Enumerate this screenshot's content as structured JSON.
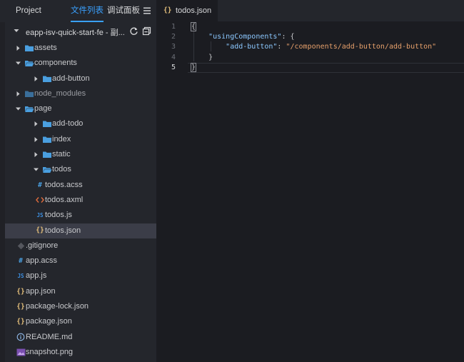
{
  "sidebar": {
    "tabs": [
      {
        "label": "Project",
        "active": false
      },
      {
        "label": "文件列表",
        "active": true
      },
      {
        "label": "调试面板",
        "active": false
      }
    ],
    "menu_icon": "menu-icon",
    "project": {
      "name": "eapp-isv-quick-start-fe - 副...",
      "refresh_icon": "refresh-icon",
      "collapse_icon": "collapse-all-icon"
    },
    "tree": [
      {
        "label": "assets",
        "type": "folder",
        "depth": 0,
        "expanded": false
      },
      {
        "label": "components",
        "type": "folder",
        "depth": 0,
        "expanded": true
      },
      {
        "label": "add-button",
        "type": "folder",
        "depth": 1,
        "expanded": false
      },
      {
        "label": "node_modules",
        "type": "folder-muted",
        "depth": 0,
        "expanded": false
      },
      {
        "label": "page",
        "type": "folder",
        "depth": 0,
        "expanded": true
      },
      {
        "label": "add-todo",
        "type": "folder",
        "depth": 1,
        "expanded": false
      },
      {
        "label": "index",
        "type": "folder",
        "depth": 1,
        "expanded": false
      },
      {
        "label": "static",
        "type": "folder",
        "depth": 1,
        "expanded": false
      },
      {
        "label": "todos",
        "type": "folder",
        "depth": 1,
        "expanded": true
      },
      {
        "label": "todos.acss",
        "type": "acss",
        "depth": 2
      },
      {
        "label": "todos.axml",
        "type": "axml",
        "depth": 2
      },
      {
        "label": "todos.js",
        "type": "js",
        "depth": 2
      },
      {
        "label": "todos.json",
        "type": "json",
        "depth": 2,
        "selected": true
      },
      {
        "label": ".gitignore",
        "type": "gitignore",
        "depth": 0
      },
      {
        "label": "app.acss",
        "type": "acss",
        "depth": 0
      },
      {
        "label": "app.js",
        "type": "js",
        "depth": 0
      },
      {
        "label": "app.json",
        "type": "json",
        "depth": 0
      },
      {
        "label": "package-lock.json",
        "type": "json",
        "depth": 0
      },
      {
        "label": "package.json",
        "type": "json",
        "depth": 0
      },
      {
        "label": "README.md",
        "type": "info",
        "depth": 0
      },
      {
        "label": "snapshot.png",
        "type": "image",
        "depth": 0
      }
    ]
  },
  "editor": {
    "tab": {
      "icon_text": "{}",
      "label": "todos.json"
    },
    "current_line": 5,
    "lines": [
      {
        "num": "1",
        "tokens": [
          {
            "t": "{",
            "c": "punc",
            "box": true
          }
        ]
      },
      {
        "num": "2",
        "tokens": [
          {
            "t": "    ",
            "c": "punc"
          },
          {
            "t": "\"usingComponents\"",
            "c": "key"
          },
          {
            "t": ": {",
            "c": "punc"
          }
        ]
      },
      {
        "num": "3",
        "tokens": [
          {
            "t": "        ",
            "c": "punc"
          },
          {
            "t": "\"add-button\"",
            "c": "key"
          },
          {
            "t": ": ",
            "c": "punc"
          },
          {
            "t": "\"/components/add-button/add-button\"",
            "c": "str"
          }
        ]
      },
      {
        "num": "4",
        "tokens": [
          {
            "t": "    }",
            "c": "punc"
          }
        ]
      },
      {
        "num": "5",
        "tokens": [
          {
            "t": "}",
            "c": "punc",
            "box": true
          }
        ]
      }
    ]
  },
  "colors": {
    "accent": "#3aa1ff",
    "folder": "#4a9fe0",
    "json": "#e5c07b",
    "acss": "#4a9fe0",
    "axml": "#e06c3c",
    "js": "#3d8fe0",
    "selected_bg": "#3b3d48"
  }
}
